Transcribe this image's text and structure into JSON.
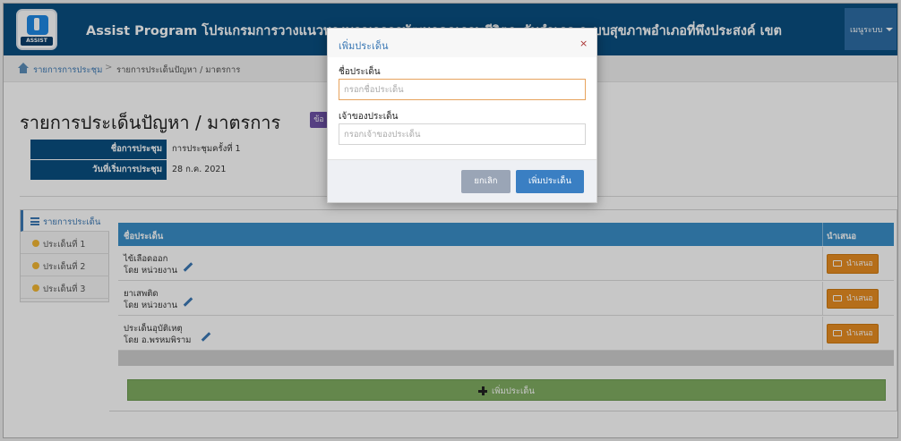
{
  "app": {
    "logo_text": "ASSIST",
    "title": "Assist Program โปรแกรมการวางแนวทางบูรณาการพัฒนาคุณภาพชีวิตระดับอำเภอ ระบบสุขภาพอำเภอที่พึงประสงค์ เขต",
    "user_menu": "เมนูระบบ"
  },
  "breadcrumb": {
    "items": [
      "รายการการประชุม",
      "รายการประเด็นปัญหา / มาตรการ"
    ],
    "separator": ">"
  },
  "page": {
    "title": "รายการประเด็นปัญหา / มาตรการ",
    "badge": "ข้อ"
  },
  "meeting": {
    "name_label": "ชื่อการประชุม",
    "name_value": "การประชุมครั้งที่ 1",
    "date_label": "วันที่เริ่มการประชุม",
    "date_value": "28 ก.ค. 2021"
  },
  "tabs": [
    {
      "label": "รายการประเด็น"
    },
    {
      "label": "ประเด็นที่ 1"
    },
    {
      "label": "ประเด็นที่ 2"
    },
    {
      "label": "ประเด็นที่ 3"
    }
  ],
  "table": {
    "headers": {
      "name": "ชื่อประเด็น",
      "action": "นำเสนอ"
    },
    "rows": [
      {
        "name": "ไข้เลือดออก",
        "owner": "โดย หน่วยงาน"
      },
      {
        "name": "ยาเสพติด",
        "owner": "โดย หน่วยงาน"
      },
      {
        "name": "ประเด็นอุบัติเหตุ",
        "owner": "โดย อ.พรหมพิราม"
      }
    ],
    "present_label": "นำเสนอ",
    "add_label": "เพิ่มประเด็น"
  },
  "modal": {
    "title": "เพิ่มประเด็น",
    "close": "×",
    "field1_label": "ชื่อประเด็น",
    "field1_placeholder": "กรอกชื่อประเด็น",
    "field2_label": "เจ้าของประเด็น",
    "field2_placeholder": "กรอกเจ้าของประเด็น",
    "cancel": "ยกเลิก",
    "submit": "เพิ่มประเด็น"
  },
  "colors": {
    "navbar": "#0a4f80",
    "table_header": "#3a8fc8",
    "present_button": "#e88d22",
    "add_bar": "#80ad62",
    "primary_button": "#3a7fc3"
  }
}
